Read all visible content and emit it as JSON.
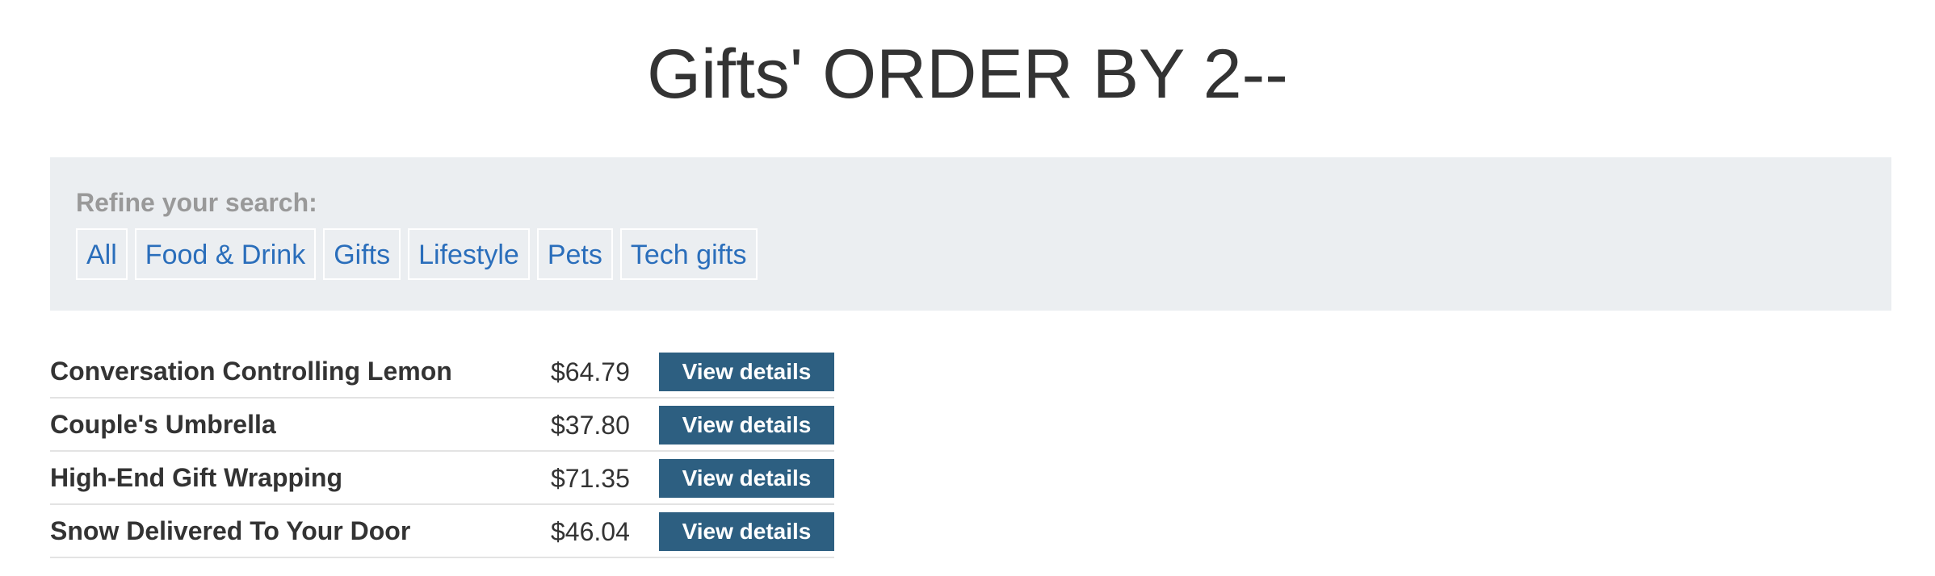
{
  "page": {
    "title": "Gifts' ORDER BY 2--"
  },
  "filters": {
    "heading": "Refine your search:",
    "items": [
      {
        "label": "All"
      },
      {
        "label": "Food & Drink"
      },
      {
        "label": "Gifts"
      },
      {
        "label": "Lifestyle"
      },
      {
        "label": "Pets"
      },
      {
        "label": "Tech gifts"
      }
    ]
  },
  "products": [
    {
      "name": "Conversation Controlling Lemon",
      "price": "$64.79",
      "action": "View details"
    },
    {
      "name": "Couple's Umbrella",
      "price": "$37.80",
      "action": "View details"
    },
    {
      "name": "High-End Gift Wrapping",
      "price": "$71.35",
      "action": "View details"
    },
    {
      "name": "Snow Delivered To Your Door",
      "price": "$46.04",
      "action": "View details"
    }
  ],
  "colors": {
    "link": "#2a6ebb",
    "panel_bg": "#ebeef1",
    "button_bg": "#2d5f81",
    "heading_muted": "#999999",
    "text": "#333333"
  }
}
